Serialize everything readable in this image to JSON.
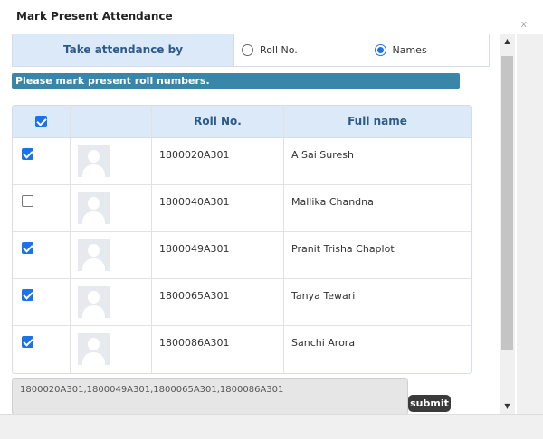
{
  "dialog": {
    "title": "Mark Present Attendance",
    "close_label": "x"
  },
  "attendance_by": {
    "label": "Take attendance by",
    "options": [
      {
        "label": "Roll No.",
        "selected": false
      },
      {
        "label": "Names",
        "selected": true
      }
    ]
  },
  "notice": "Please mark present roll numbers.",
  "table": {
    "headers": {
      "select_all_checked": true,
      "roll_no": "Roll No.",
      "full_name": "Full name"
    },
    "rows": [
      {
        "checked": true,
        "roll_no": "1800020A301",
        "name": "A Sai Suresh"
      },
      {
        "checked": false,
        "roll_no": "1800040A301",
        "name": "Mallika Chandna"
      },
      {
        "checked": true,
        "roll_no": "1800049A301",
        "name": "Pranit Trisha Chaplot"
      },
      {
        "checked": true,
        "roll_no": "1800065A301",
        "name": "Tanya Tewari"
      },
      {
        "checked": true,
        "roll_no": "1800086A301",
        "name": "Sanchi Arora"
      }
    ]
  },
  "selected_rolls": "1800020A301,1800049A301,1800065A301,1800086A301",
  "submit_label": "submit",
  "colors": {
    "header_bg": "#dce9f9",
    "notice_bg": "#3a86a8",
    "accent": "#1a73e8",
    "submit_bg": "#3a3a3a"
  }
}
